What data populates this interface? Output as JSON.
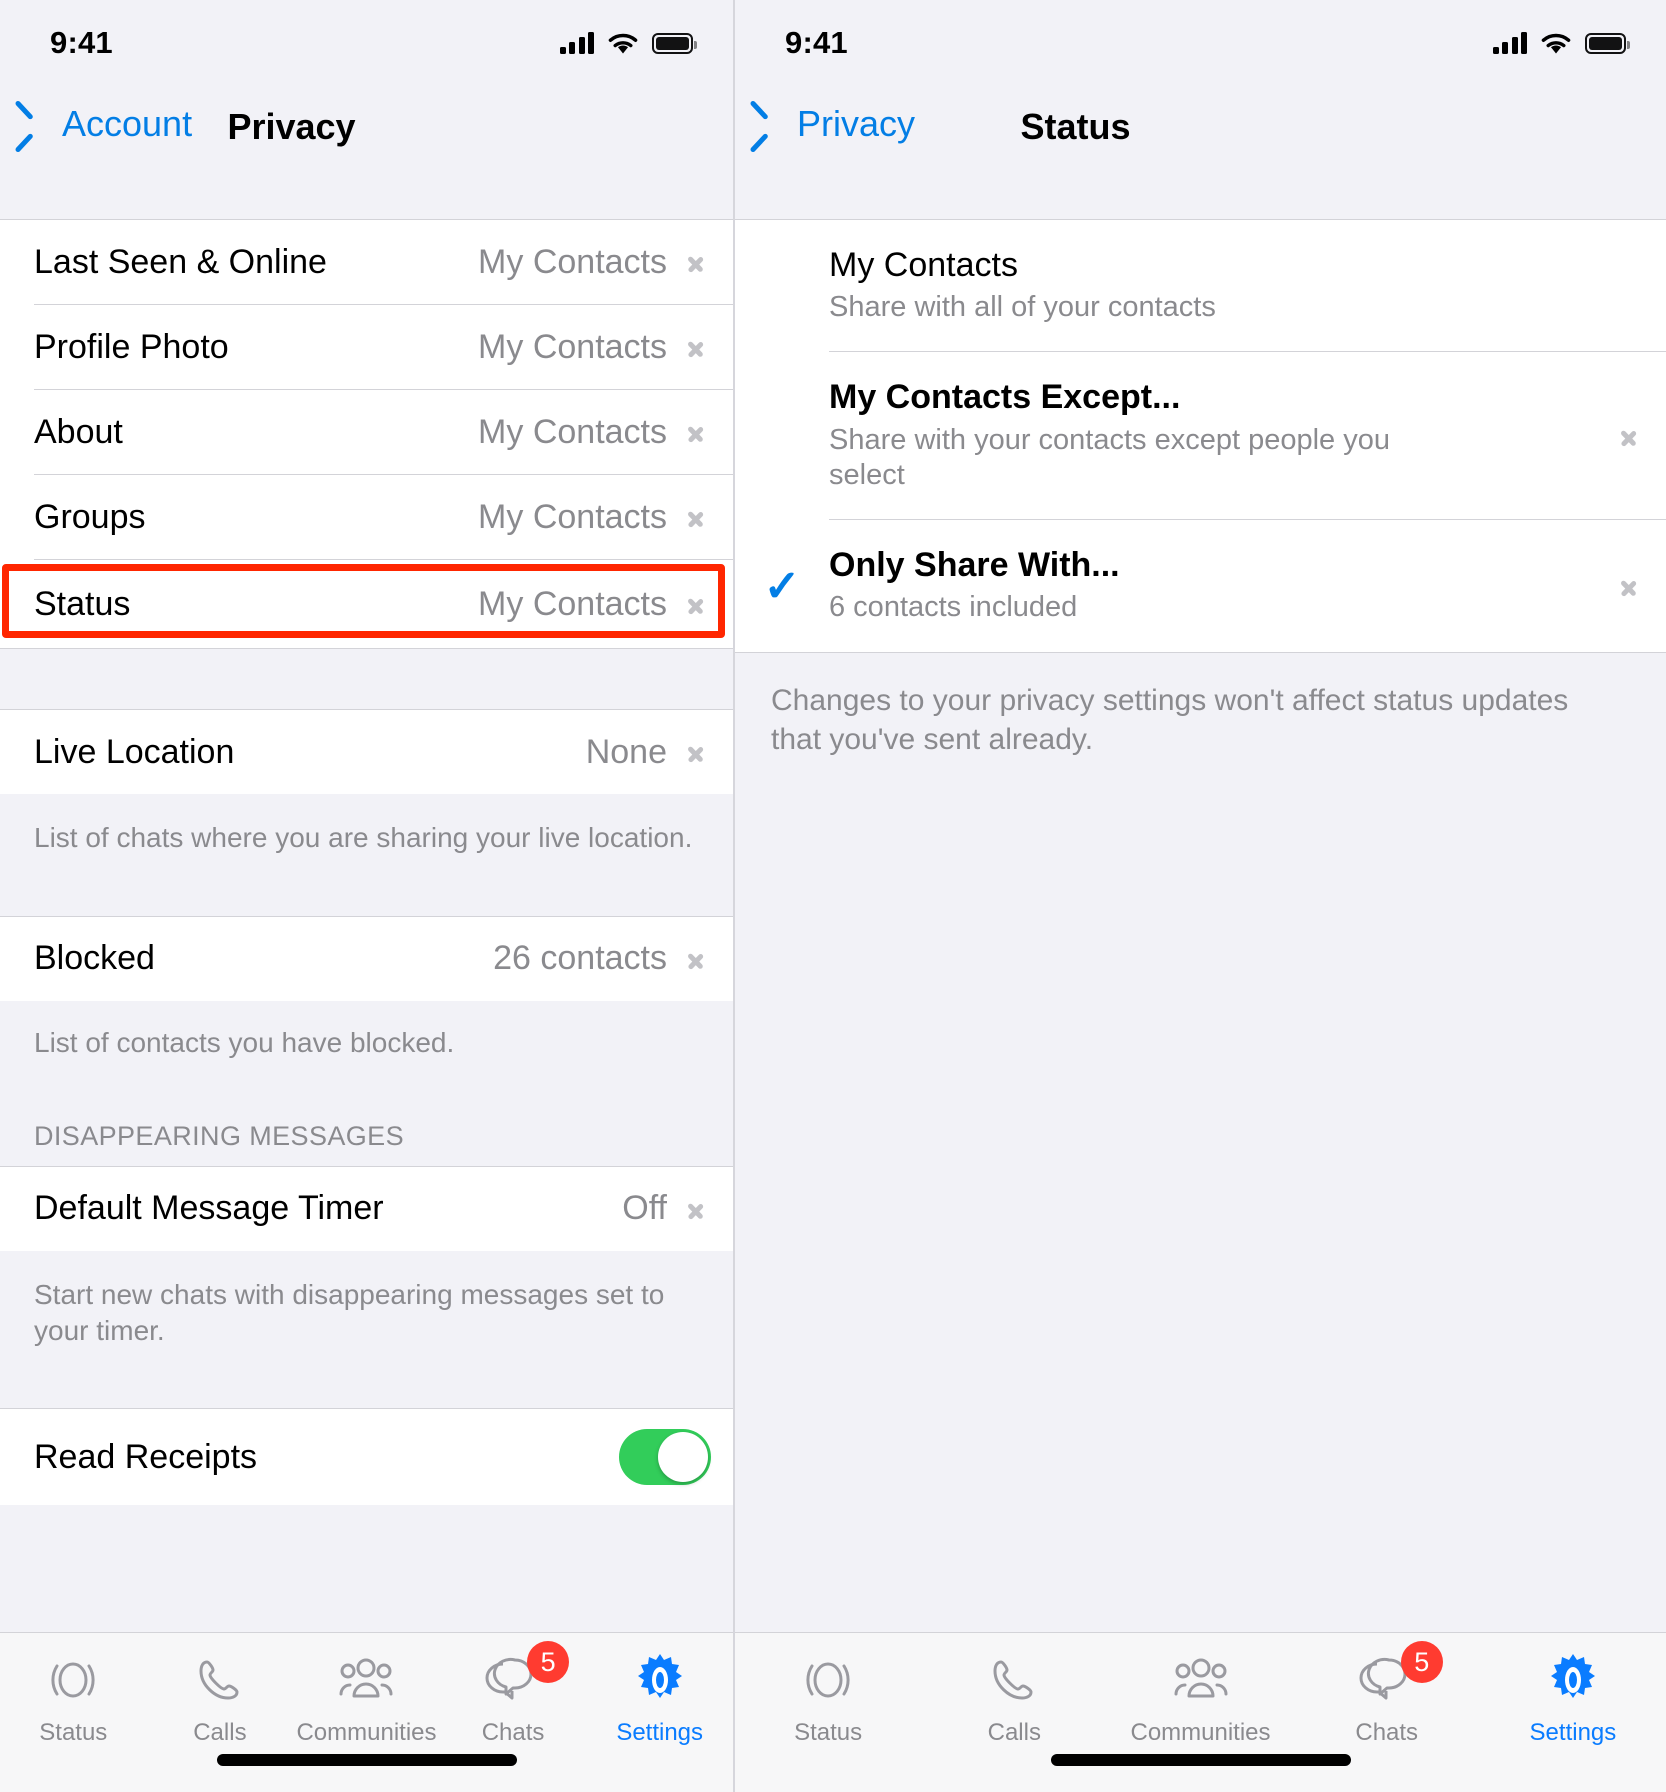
{
  "status_bar": {
    "time": "9:41"
  },
  "left_screen": {
    "nav": {
      "back_label": "Account",
      "title": "Privacy"
    },
    "rows_group1": [
      {
        "title": "Last Seen & Online",
        "value": "My Contacts"
      },
      {
        "title": "Profile Photo",
        "value": "My Contacts"
      },
      {
        "title": "About",
        "value": "My Contacts"
      },
      {
        "title": "Groups",
        "value": "My Contacts"
      },
      {
        "title": "Status",
        "value": "My Contacts"
      }
    ],
    "live_location": {
      "title": "Live Location",
      "value": "None"
    },
    "live_location_caption": "List of chats where you are sharing your live location.",
    "blocked": {
      "title": "Blocked",
      "value": "26 contacts"
    },
    "blocked_caption": "List of contacts you have blocked.",
    "disappearing_header": "DISAPPEARING MESSAGES",
    "default_timer": {
      "title": "Default Message Timer",
      "value": "Off"
    },
    "default_timer_caption": "Start new chats with disappearing messages set to your timer.",
    "read_receipts": {
      "title": "Read Receipts",
      "state": "on"
    },
    "highlight_color": "#ff2600"
  },
  "right_screen": {
    "nav": {
      "back_label": "Privacy",
      "title": "Status"
    },
    "options": [
      {
        "title": "My Contacts",
        "subtitle": "Share with all of your contacts",
        "selected": true,
        "has_chevron": false,
        "bold": false
      },
      {
        "title": "My Contacts Except...",
        "subtitle": "Share with your contacts except people you select",
        "selected": false,
        "has_chevron": true,
        "bold": true
      },
      {
        "title": "Only Share With...",
        "subtitle": "6 contacts included",
        "selected": true,
        "has_chevron": true,
        "bold": true
      }
    ],
    "footnote": "Changes to your privacy settings won't affect status updates that you've sent already."
  },
  "tabbar": {
    "tabs": [
      {
        "label": "Status",
        "icon": "status-rings-icon",
        "active": false,
        "badge": ""
      },
      {
        "label": "Calls",
        "icon": "phone-icon",
        "active": false,
        "badge": ""
      },
      {
        "label": "Communities",
        "icon": "communities-icon",
        "active": false,
        "badge": ""
      },
      {
        "label": "Chats",
        "icon": "chat-bubbles-icon",
        "active": false,
        "badge": "5"
      },
      {
        "label": "Settings",
        "icon": "gear-icon",
        "active": true,
        "badge": ""
      }
    ]
  },
  "colors": {
    "accent": "#037ee5",
    "toggle_on": "#32cd5a",
    "badge": "#ff3b30",
    "highlight": "#ff2600",
    "muted": "#8a8a8e"
  }
}
